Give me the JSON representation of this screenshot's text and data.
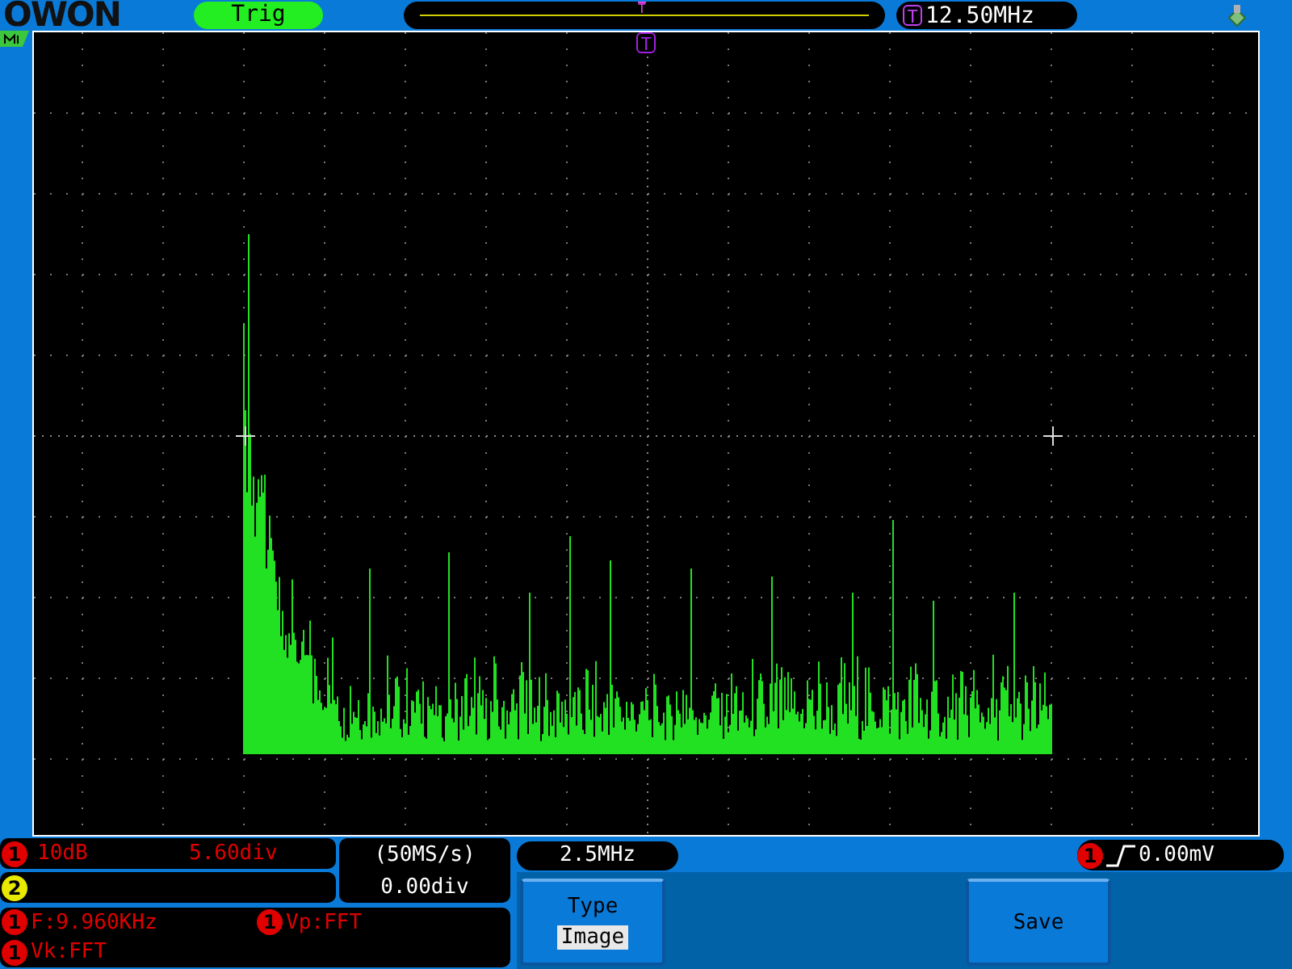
{
  "header": {
    "logo": "OWON",
    "trigger_status": "Trig",
    "timeline_marker": "T",
    "trigger_marker": "T",
    "trigger_frequency": "12.50MHz",
    "position_marker": "T"
  },
  "channels": [
    {
      "number": "1",
      "color": "#e00000",
      "scale": "10dB",
      "position": "5.60div"
    },
    {
      "number": "2",
      "color": "#e8e800"
    }
  ],
  "timebase": {
    "sample_rate": "(50MS/s)",
    "offset": "0.00div"
  },
  "fft_frequency": "2.5MHz",
  "trigger": {
    "channel": "1",
    "level": "0.00mV"
  },
  "measurements": [
    {
      "channel": "1",
      "text": "F:9.960KHz"
    },
    {
      "channel": "1",
      "text": "Vp:FFT"
    },
    {
      "channel": "1",
      "text": "Vk:FFT"
    }
  ],
  "menu": [
    {
      "kind": "option",
      "label": "Type",
      "value": "Image"
    },
    {
      "kind": "blank"
    },
    {
      "kind": "blank"
    },
    {
      "kind": "button",
      "label": "Save"
    }
  ]
}
